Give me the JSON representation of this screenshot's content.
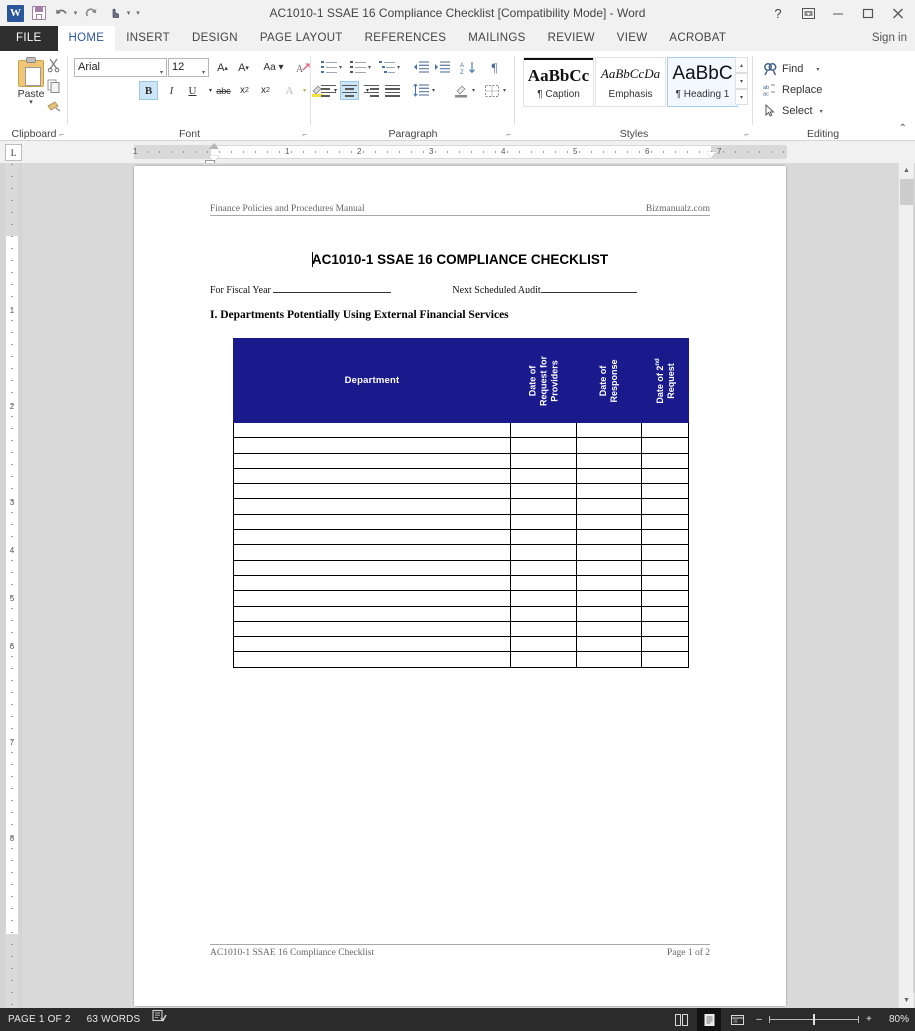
{
  "window": {
    "title": "AC1010-1 SSAE 16 Compliance Checklist [Compatibility Mode] - Word",
    "app_icon": "word-icon",
    "sign_in": "Sign in"
  },
  "quick_access": [
    {
      "name": "save-icon",
      "label": "Save"
    },
    {
      "name": "undo-icon",
      "label": "Undo"
    },
    {
      "name": "redo-icon",
      "label": "Redo"
    },
    {
      "name": "touch-mode-icon",
      "label": "Touch/Mouse Mode"
    },
    {
      "name": "customize-qat-icon",
      "label": "Customize Quick Access Toolbar"
    }
  ],
  "window_controls": [
    {
      "name": "help-button",
      "glyph": "?"
    },
    {
      "name": "ribbon-display-options-button",
      "glyph": "⬒"
    },
    {
      "name": "minimize-button",
      "glyph": "–"
    },
    {
      "name": "maximize-button",
      "glyph": "❐"
    },
    {
      "name": "close-button",
      "glyph": "✕"
    }
  ],
  "tabs": [
    {
      "label": "FILE",
      "active": false,
      "file": true
    },
    {
      "label": "HOME",
      "active": true
    },
    {
      "label": "INSERT",
      "active": false
    },
    {
      "label": "DESIGN",
      "active": false
    },
    {
      "label": "PAGE LAYOUT",
      "active": false
    },
    {
      "label": "REFERENCES",
      "active": false
    },
    {
      "label": "MAILINGS",
      "active": false
    },
    {
      "label": "REVIEW",
      "active": false
    },
    {
      "label": "VIEW",
      "active": false
    },
    {
      "label": "ACROBAT",
      "active": false
    }
  ],
  "ribbon": {
    "clipboard": {
      "label": "Clipboard",
      "paste_label": "Paste",
      "buttons": [
        "cut-icon",
        "copy-icon",
        "format-painter-icon"
      ]
    },
    "font": {
      "label": "Font",
      "font_name": "Arial",
      "font_size": "12",
      "buttons": [
        "grow-font-icon",
        "shrink-font-icon",
        "change-case-icon",
        "clear-formatting-icon",
        "bold-icon",
        "italic-icon",
        "underline-icon",
        "strikethrough-icon",
        "subscript-icon",
        "superscript-icon",
        "text-effects-icon",
        "text-highlight-color-icon",
        "font-color-icon"
      ],
      "bold_active": true
    },
    "paragraph": {
      "label": "Paragraph",
      "buttons": [
        "bullets-icon",
        "numbering-icon",
        "multilevel-list-icon",
        "decrease-indent-icon",
        "increase-indent-icon",
        "sort-icon",
        "show-formatting-marks-icon",
        "align-left-icon",
        "align-center-icon",
        "align-right-icon",
        "justify-icon",
        "line-spacing-icon",
        "shading-icon",
        "borders-icon"
      ],
      "align_center_active": true
    },
    "styles": {
      "label": "Styles",
      "items": [
        {
          "preview": "AaBbCc",
          "name": "Caption",
          "selected": false,
          "pilcrow": true
        },
        {
          "preview": "AaBbCcDa",
          "name": "Emphasis",
          "selected": false,
          "pilcrow": false
        },
        {
          "preview": "AaBbC",
          "name": "Heading 1",
          "selected": true,
          "pilcrow": true
        }
      ]
    },
    "editing": {
      "label": "Editing",
      "find": "Find",
      "replace": "Replace",
      "select": "Select"
    },
    "collapse_ribbon": "collapse-ribbon-icon"
  },
  "rulers": {
    "tab_selector": "L",
    "horizontal_numbers": [
      "1",
      "1",
      "2",
      "3",
      "4",
      "5",
      "6",
      "7"
    ],
    "vertical_numbers": [
      "1",
      "2",
      "3",
      "4",
      "5",
      "6",
      "7",
      "8"
    ]
  },
  "document": {
    "header_left": "Finance Policies and Procedures Manual",
    "header_right": "Bizmanualz.com",
    "title": "AC1010-1 SSAE 16 COMPLIANCE CHECKLIST",
    "fiscal_year_label": "For Fiscal Year",
    "next_audit_label": "Next Scheduled Audit",
    "section_heading": "I. Departments Potentially Using External Financial Services",
    "table": {
      "header_fill": "#1a1a8c",
      "header_text_color": "#ffffff",
      "columns": [
        {
          "label": "Department",
          "rotated": false
        },
        {
          "label": "Date of Request for Providers",
          "rotated": true
        },
        {
          "label": "Date of Response",
          "rotated": true
        },
        {
          "label": "Date of 2nd Request",
          "rotated": true,
          "superscript": "nd"
        }
      ],
      "empty_row_count": 16
    },
    "footer_left": "AC1010-1 SSAE 16 Compliance Checklist",
    "footer_right": "Page 1 of 2"
  },
  "status_bar": {
    "page": "PAGE 1 OF 2",
    "words": "63 WORDS",
    "proofing_icon": "proofing-errors-icon",
    "view_buttons": [
      {
        "name": "read-mode-icon",
        "active": false
      },
      {
        "name": "print-layout-icon",
        "active": true
      },
      {
        "name": "web-layout-icon",
        "active": false
      }
    ],
    "zoom_out": "–",
    "zoom_in": "+",
    "zoom_level": "80%"
  }
}
